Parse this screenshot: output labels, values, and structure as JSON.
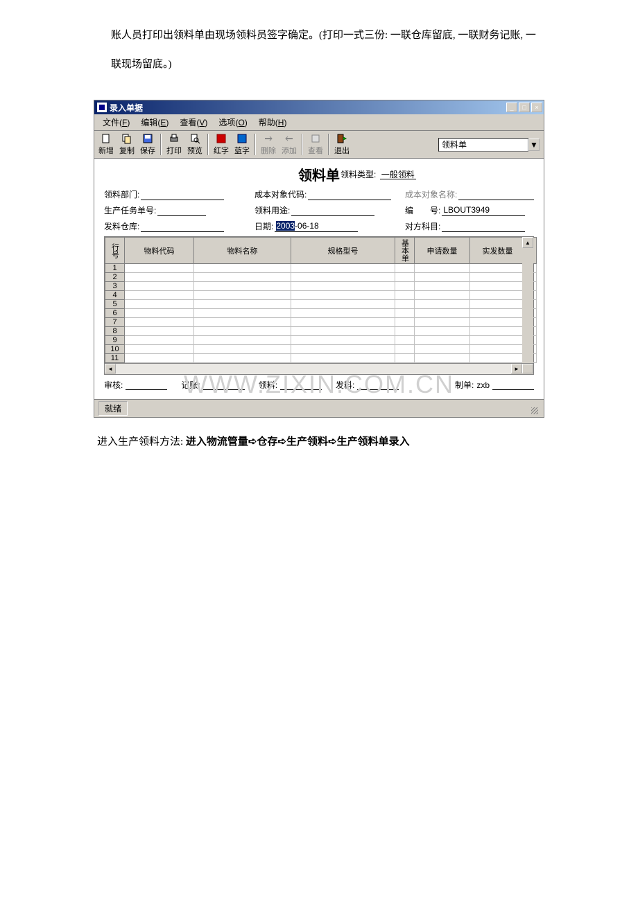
{
  "doc": {
    "para1": "账人员打印出领料单由现场领料员签字确定。(打印一式三份: 一联仓库留底, 一联财务记账, 一联现场留底。)",
    "para2_prefix": "进入生产领料方法: ",
    "para2_bold": "进入物流管量➪仓存➪生产领料➪生产领料单录入"
  },
  "window": {
    "title": "录入单据",
    "menus": [
      {
        "label": "文件",
        "key": "F"
      },
      {
        "label": "编辑",
        "key": "E"
      },
      {
        "label": "查看",
        "key": "V"
      },
      {
        "label": "选项",
        "key": "O"
      },
      {
        "label": "帮助",
        "key": "H"
      }
    ],
    "toolbar": [
      {
        "name": "new",
        "label": "新增",
        "disabled": false
      },
      {
        "name": "copy",
        "label": "复制",
        "disabled": false
      },
      {
        "name": "save",
        "label": "保存",
        "disabled": false
      },
      {
        "sep": true
      },
      {
        "name": "print",
        "label": "打印",
        "disabled": false
      },
      {
        "name": "preview",
        "label": "预览",
        "disabled": false
      },
      {
        "sep": true
      },
      {
        "name": "red",
        "label": "红字",
        "disabled": false
      },
      {
        "name": "blue",
        "label": "蓝字",
        "disabled": false
      },
      {
        "sep": true
      },
      {
        "name": "delete",
        "label": "删除",
        "disabled": true
      },
      {
        "name": "add",
        "label": "添加",
        "disabled": true
      },
      {
        "sep": true
      },
      {
        "name": "view",
        "label": "查看",
        "disabled": true
      },
      {
        "sep": true
      },
      {
        "name": "exit",
        "label": "退出",
        "disabled": false
      }
    ],
    "doc_type": "领料单",
    "form": {
      "title": "领料单",
      "subtitle_label": "领料类型:",
      "subtitle_value": "一般领料",
      "fields": {
        "dept_label": "领料部门:",
        "cost_code_label": "成本对象代码:",
        "cost_name_label": "成本对象名称:",
        "task_label": "生产任务单号:",
        "usage_label": "领料用途:",
        "serial_label": "编  号:",
        "serial_value": "LBOUT3949",
        "warehouse_label": "发料仓库:",
        "date_label": "日期:",
        "date_value": "2003-06-18",
        "account_label": "对方科目:"
      },
      "columns": [
        "行号",
        "物料代码",
        "物料名称",
        "规格型号",
        "基本单",
        "申请数量",
        "实发数量"
      ],
      "rows": [
        1,
        2,
        3,
        4,
        5,
        6,
        7,
        8,
        9,
        10,
        11
      ]
    },
    "footer": {
      "audit": "审核:",
      "book": "记账:",
      "pick": "领料:",
      "issue": "发料:",
      "maker_label": "制单:",
      "maker_value": "zxb"
    },
    "status": "就绪",
    "watermark": "WWW.ZIXIN.COM.CN"
  }
}
